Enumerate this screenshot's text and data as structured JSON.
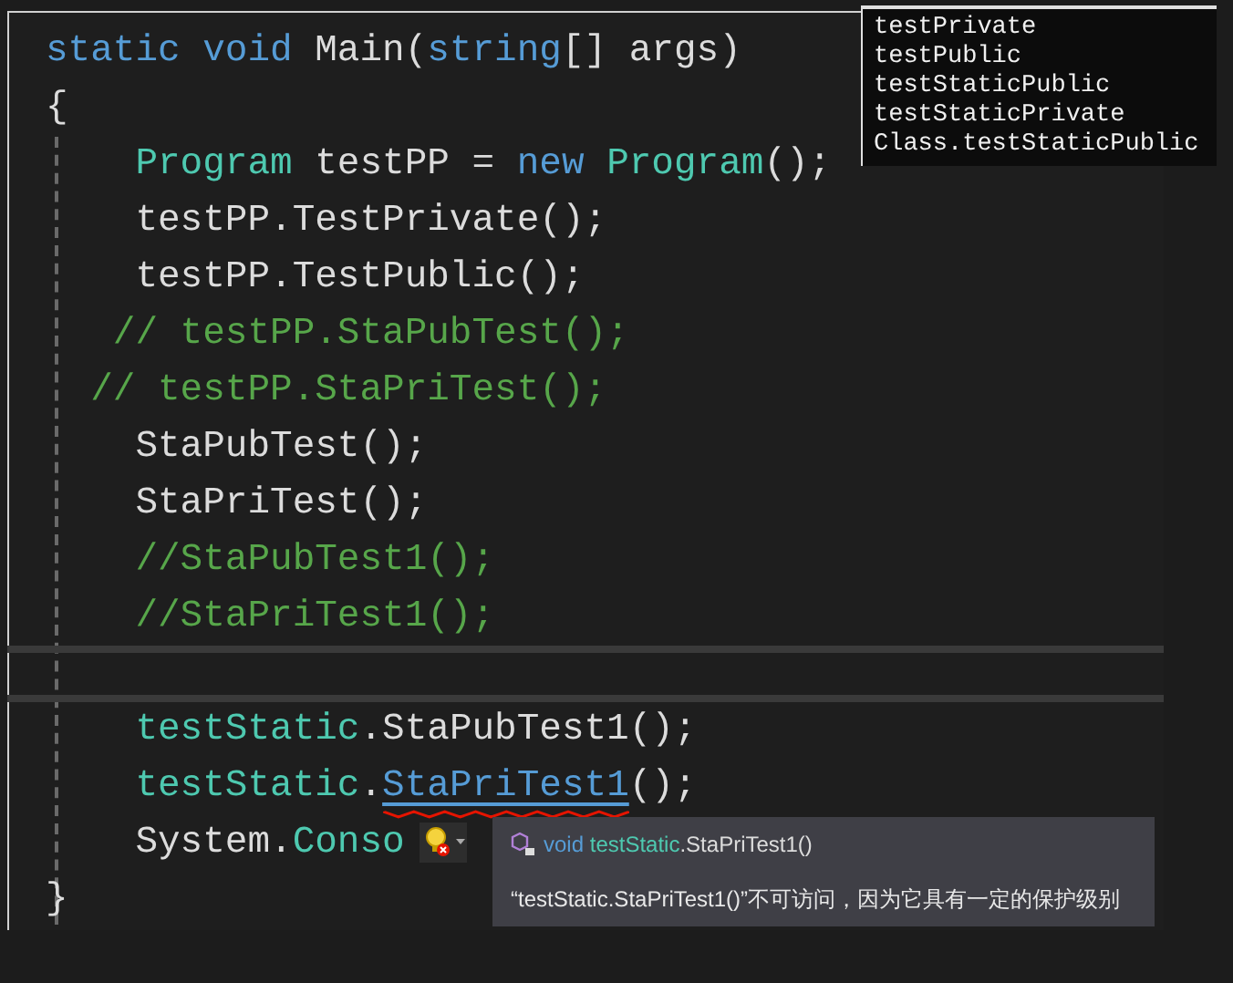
{
  "editor": {
    "lines": [
      {
        "kind": "code",
        "tokens": [
          {
            "text": "static void ",
            "kind": "keyword"
          },
          {
            "text": "Main(",
            "kind": "plain"
          },
          {
            "text": "string",
            "kind": "keyword"
          },
          {
            "text": "[] args)",
            "kind": "plain"
          }
        ]
      },
      {
        "kind": "code",
        "tokens": [
          {
            "text": "{",
            "kind": "plain"
          }
        ]
      },
      {
        "kind": "code",
        "tokens": [
          {
            "text": "    Program",
            "kind": "type"
          },
          {
            "text": " testPP = ",
            "kind": "plain"
          },
          {
            "text": "new ",
            "kind": "keyword"
          },
          {
            "text": "Program",
            "kind": "type"
          },
          {
            "text": "();",
            "kind": "plain"
          }
        ]
      },
      {
        "kind": "code",
        "tokens": [
          {
            "text": "    testPP.TestPrivate();",
            "kind": "plain"
          }
        ]
      },
      {
        "kind": "code",
        "tokens": [
          {
            "text": "    testPP.TestPublic();",
            "kind": "plain"
          }
        ]
      },
      {
        "kind": "code",
        "tokens": [
          {
            "text": "   // testPP.StaPubTest();",
            "kind": "comment"
          }
        ]
      },
      {
        "kind": "code",
        "tokens": [
          {
            "text": "  // testPP.StaPriTest();",
            "kind": "comment"
          }
        ]
      },
      {
        "kind": "code",
        "tokens": [
          {
            "text": "    StaPubTest();",
            "kind": "plain"
          }
        ]
      },
      {
        "kind": "code",
        "tokens": [
          {
            "text": "    StaPriTest();",
            "kind": "plain"
          }
        ]
      },
      {
        "kind": "code",
        "tokens": [
          {
            "text": "    //StaPubTest1();",
            "kind": "comment"
          }
        ]
      },
      {
        "kind": "code",
        "tokens": [
          {
            "text": "    //StaPriTest1();",
            "kind": "comment"
          }
        ]
      },
      {
        "kind": "separator"
      },
      {
        "kind": "code",
        "tokens": [
          {
            "text": "    testStatic",
            "kind": "type"
          },
          {
            "text": ".StaPubTest1();",
            "kind": "plain"
          }
        ]
      },
      {
        "kind": "code",
        "tokens": [
          {
            "text": "    testStatic",
            "kind": "type"
          },
          {
            "text": ".",
            "kind": "plain"
          },
          {
            "text": "StaPriTest1",
            "kind": "error"
          },
          {
            "text": "();",
            "kind": "plain"
          }
        ]
      },
      {
        "kind": "code",
        "tokens": [
          {
            "text": "    System.",
            "kind": "plain"
          },
          {
            "text": "Conso",
            "kind": "type"
          }
        ]
      },
      {
        "kind": "code",
        "tokens": [
          {
            "text": "}",
            "kind": "plain"
          }
        ]
      }
    ]
  },
  "completion_list": {
    "items": [
      {
        "label": "testPrivate",
        "selected": false
      },
      {
        "label": "testPublic",
        "selected": false
      },
      {
        "label": "testStaticPublic",
        "selected": false
      },
      {
        "label": "testStaticPrivate",
        "selected": false
      },
      {
        "label": "Class.testStaticPublic",
        "selected": false
      }
    ]
  },
  "tooltip": {
    "signature": [
      {
        "text": "void ",
        "kind": "keyword"
      },
      {
        "text": "testStatic",
        "kind": "type"
      },
      {
        "text": ".StaPriTest1()",
        "kind": "plain"
      }
    ],
    "message": "“testStatic.StaPriTest1()”不可访问，因为它具有一定的保护级别"
  }
}
